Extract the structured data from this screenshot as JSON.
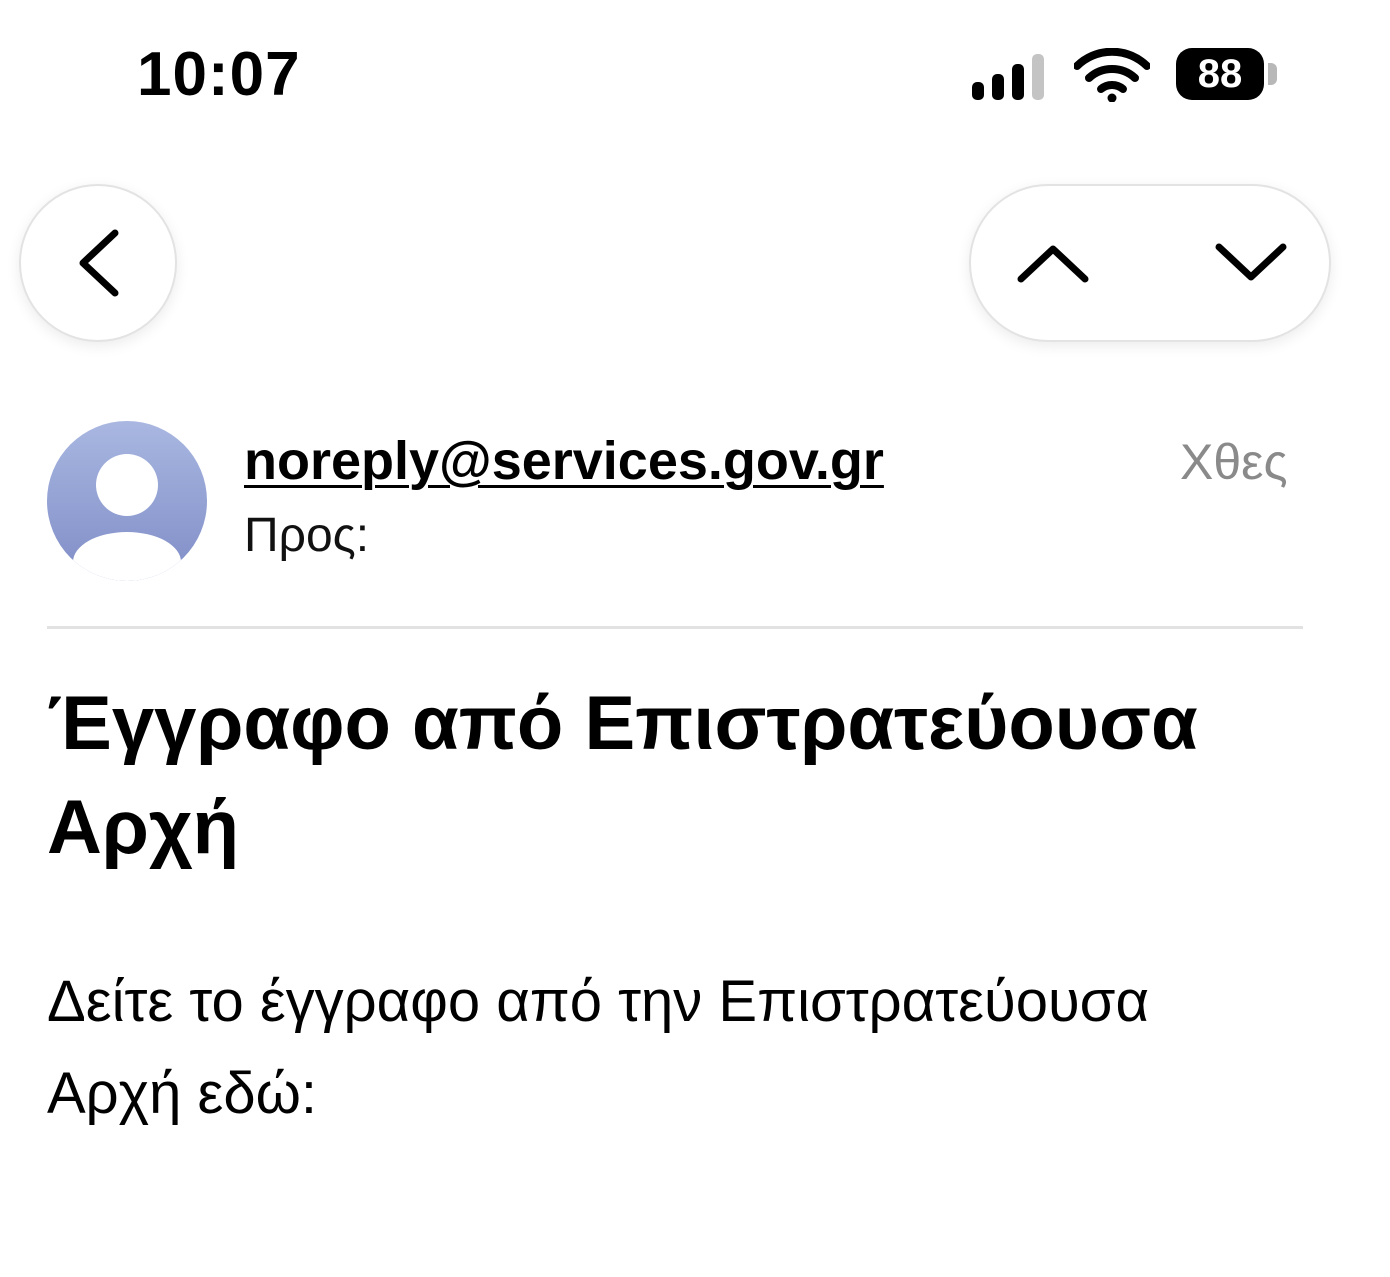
{
  "status_bar": {
    "time": "10:07",
    "battery_level": "88",
    "signal_icon": "cellular-signal-icon",
    "wifi_icon": "wifi-icon"
  },
  "navigation": {
    "back_icon": "chevron-left-icon",
    "previous_icon": "chevron-up-icon",
    "next_icon": "chevron-down-icon"
  },
  "email": {
    "sender": "noreply@services.gov.gr",
    "to_label": "Προς:",
    "to_value": "",
    "date": "Χθες",
    "subject": "Έγγραφο από Επιστρατεύουσα Αρχή",
    "body_line1": "Δείτε το έγγραφο από την Επιστρατεύουσα",
    "body_line2_prefix": "Αρχή εδώ:",
    "link_part1": "",
    "link_part2": ""
  },
  "colors": {
    "link": "#3d8ff0",
    "avatar_top": "#a9b7e1",
    "avatar_bottom": "#7f8dc7",
    "date_text": "#8a8a8a"
  }
}
